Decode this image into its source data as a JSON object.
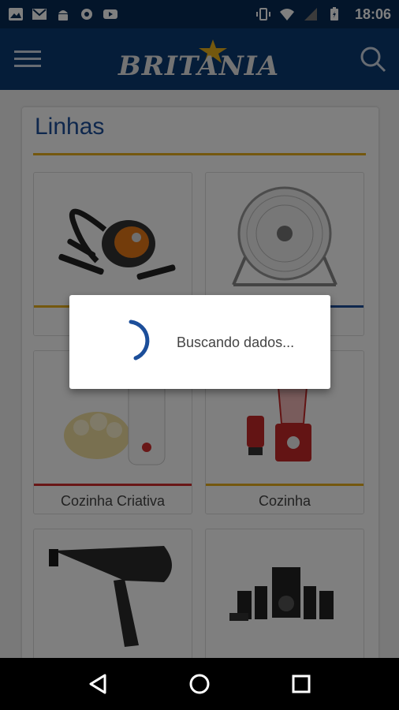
{
  "status_bar": {
    "time": "18:06",
    "icons_left": [
      "image-icon",
      "gmail-icon",
      "android-icon",
      "settings-badge-icon",
      "youtube-icon"
    ],
    "icons_right": [
      "vibrate-icon",
      "wifi-icon",
      "signal-icon",
      "battery-charging-icon"
    ]
  },
  "app_bar": {
    "logo_text": "BRITANIA",
    "menu_icon": "hamburger-icon",
    "search_icon": "search-icon",
    "colors": {
      "background": "#0b3a73",
      "status": "#062a55",
      "accent": "#e8b11c"
    }
  },
  "section": {
    "title": "Linhas"
  },
  "categories": [
    {
      "label": "",
      "image": "vacuum-cleaner",
      "bar_color": "#e8b11c"
    },
    {
      "label": "",
      "image": "floor-fan",
      "bar_color": "#1c4e9a"
    },
    {
      "label": "Cozinha Criativa",
      "image": "popcorn-maker",
      "bar_color": "#d32f2f"
    },
    {
      "label": "Cozinha",
      "image": "blender",
      "bar_color": "#e8b11c"
    },
    {
      "label": "",
      "image": "hair-dryer",
      "bar_color": ""
    },
    {
      "label": "",
      "image": "speaker-system",
      "bar_color": ""
    }
  ],
  "dialog": {
    "message": "Buscando dados..."
  },
  "nav_bar": {
    "buttons": [
      "back-icon",
      "home-icon",
      "recents-icon"
    ]
  }
}
